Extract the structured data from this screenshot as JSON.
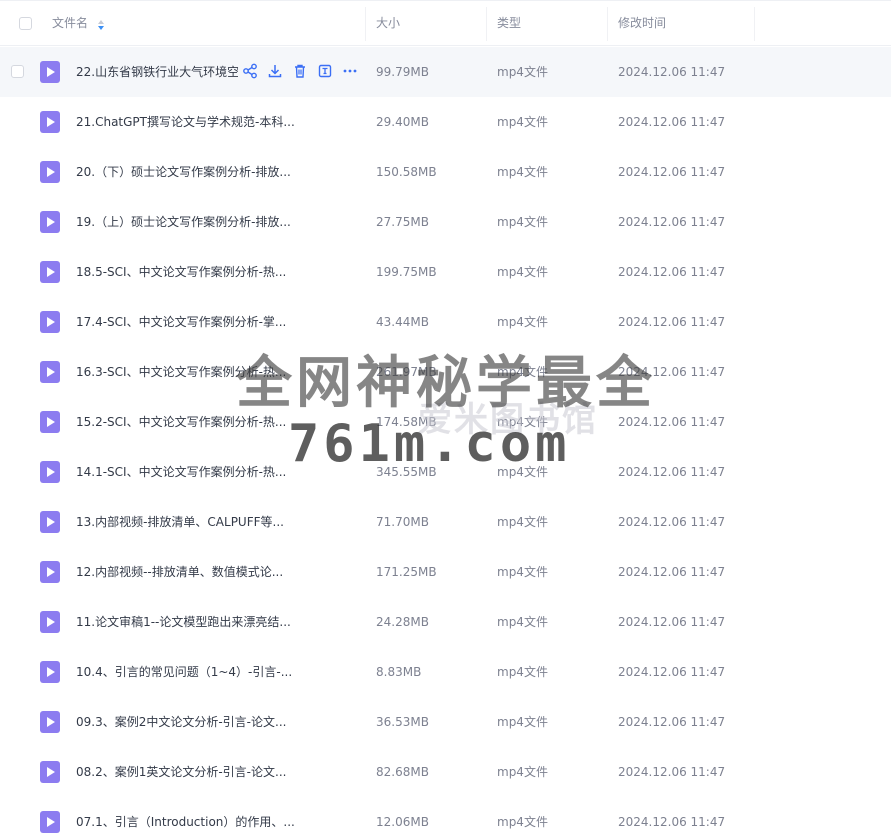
{
  "header": {
    "name_label": "文件名",
    "size_label": "大小",
    "type_label": "类型",
    "time_label": "修改时间",
    "sort_icon": "sort-arrows-icon"
  },
  "hover_actions": [
    "share-icon",
    "download-icon",
    "delete-icon",
    "rename-icon",
    "more-icon"
  ],
  "files": [
    {
      "name": "22.山东省钢铁行业大气环境空",
      "size": "99.79MB",
      "type": "mp4文件",
      "time": "2024.12.06 11:47"
    },
    {
      "name": "21.ChatGPT撰写论文与学术规范-本科...",
      "size": "29.40MB",
      "type": "mp4文件",
      "time": "2024.12.06 11:47"
    },
    {
      "name": "20.（下）硕士论文写作案例分析-排放...",
      "size": "150.58MB",
      "type": "mp4文件",
      "time": "2024.12.06 11:47"
    },
    {
      "name": "19.（上）硕士论文写作案例分析-排放...",
      "size": "27.75MB",
      "type": "mp4文件",
      "time": "2024.12.06 11:47"
    },
    {
      "name": "18.5-SCI、中文论文写作案例分析-热...",
      "size": "199.75MB",
      "type": "mp4文件",
      "time": "2024.12.06 11:47"
    },
    {
      "name": "17.4-SCI、中文论文写作案例分析-掌...",
      "size": "43.44MB",
      "type": "mp4文件",
      "time": "2024.12.06 11:47"
    },
    {
      "name": "16.3-SCI、中文论文写作案例分析-热...",
      "size": "261.97MB",
      "type": "mp4文件",
      "time": "2024.12.06 11:47"
    },
    {
      "name": "15.2-SCI、中文论文写作案例分析-热...",
      "size": "174.58MB",
      "type": "mp4文件",
      "time": "2024.12.06 11:47"
    },
    {
      "name": "14.1-SCI、中文论文写作案例分析-热...",
      "size": "345.55MB",
      "type": "mp4文件",
      "time": "2024.12.06 11:47"
    },
    {
      "name": "13.内部视频-排放清单、CALPUFF等...",
      "size": "71.70MB",
      "type": "mp4文件",
      "time": "2024.12.06 11:47"
    },
    {
      "name": "12.内部视频--排放清单、数值模式论...",
      "size": "171.25MB",
      "type": "mp4文件",
      "time": "2024.12.06 11:47"
    },
    {
      "name": "11.论文审稿1--论文模型跑出来漂亮结...",
      "size": "24.28MB",
      "type": "mp4文件",
      "time": "2024.12.06 11:47"
    },
    {
      "name": "10.4、引言的常见问题（1~4）-引言-...",
      "size": "8.83MB",
      "type": "mp4文件",
      "time": "2024.12.06 11:47"
    },
    {
      "name": "09.3、案例2中文论文分析-引言-论文...",
      "size": "36.53MB",
      "type": "mp4文件",
      "time": "2024.12.06 11:47"
    },
    {
      "name": "08.2、案例1英文论文分析-引言-论文...",
      "size": "82.68MB",
      "type": "mp4文件",
      "time": "2024.12.06 11:47"
    },
    {
      "name": "07.1、引言（Introduction）的作用、...",
      "size": "12.06MB",
      "type": "mp4文件",
      "time": "2024.12.06 11:47"
    }
  ],
  "watermark": {
    "line1": "全网神秘学最全",
    "line2": "761m.com",
    "logo": "爱米图书馆"
  },
  "colors": {
    "file_icon": "#8c7cf0",
    "action_icon": "#3b6ff5",
    "hover_row": "#f5f7fa"
  }
}
